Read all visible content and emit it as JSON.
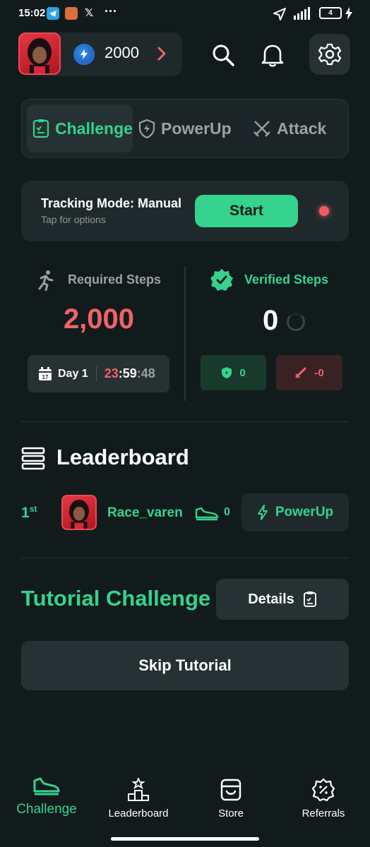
{
  "status_bar": {
    "time": "15:02",
    "battery": "4",
    "x_label": "𝕏",
    "more": "···"
  },
  "header": {
    "coins": "2000"
  },
  "tabs": [
    {
      "label": "Challenge",
      "active": true
    },
    {
      "label": "PowerUp",
      "active": false
    },
    {
      "label": "Attack",
      "active": false
    }
  ],
  "tracking": {
    "title": "Tracking Mode: Manual",
    "subtitle": "Tap for options",
    "start_label": "Start"
  },
  "steps": {
    "required_label": "Required Steps",
    "required_value": "2,000",
    "verified_label": "Verified Steps",
    "verified_value": "0",
    "day_label": "Day 1",
    "calendar_day": "17",
    "timer_h": "23",
    "timer_sep1": ":",
    "timer_m": "59",
    "timer_sep2": ":",
    "timer_s": "48",
    "shield_count": "0",
    "attack_count": "-0"
  },
  "leaderboard": {
    "title": "Leaderboard",
    "rows": [
      {
        "rank": "1",
        "rank_suffix": "st",
        "name": "Race_varen",
        "steps": "0",
        "action_label": "PowerUp"
      }
    ]
  },
  "tutorial": {
    "title": "Tutorial Challenge",
    "details_label": "Details",
    "skip_label": "Skip Tutorial"
  },
  "bottom_nav": [
    {
      "label": "Challenge",
      "icon": "shoe-icon",
      "active": true
    },
    {
      "label": "Leaderboard",
      "icon": "podium-icon",
      "active": false
    },
    {
      "label": "Store",
      "icon": "store-icon",
      "active": false
    },
    {
      "label": "Referrals",
      "icon": "referral-badge-icon",
      "active": false
    }
  ],
  "colors": {
    "background": "#121b1c",
    "card": "#1f292b",
    "accent_green": "#35d38e",
    "accent_red": "#f0626a",
    "muted": "#9aa2a4"
  }
}
